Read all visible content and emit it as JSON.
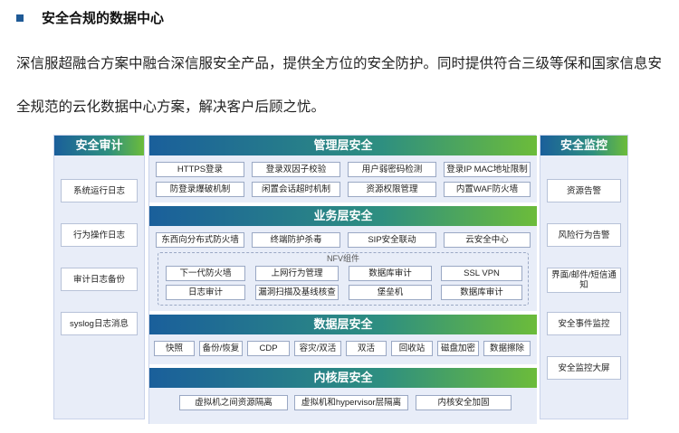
{
  "heading": "安全合规的数据中心",
  "paragraph": {
    "line1": "深信服超融合方案中融合深信服安全产品，提供全方位的安全防护。同时提供符合三级等保和国家信息安",
    "line2": "全规范的云化数据中心方案，解决客户后顾之忧。"
  },
  "left_panel": {
    "title": "安全审计",
    "items": [
      "系统运行日志",
      "行为操作日志",
      "审计日志备份",
      "syslog日志消息"
    ]
  },
  "right_panel": {
    "title": "安全监控",
    "items": [
      "资源告警",
      "风险行为告警",
      "界面/邮件/短信通知",
      "安全事件监控",
      "安全监控大屏"
    ]
  },
  "sections": {
    "management": {
      "title": "管理层安全",
      "row1": [
        "HTTPS登录",
        "登录双因子校验",
        "用户弱密码检测",
        "登录IP MAC地址限制"
      ],
      "row2": [
        "防登录爆破机制",
        "闲置会话超时机制",
        "资源权限管理",
        "内置WAF防火墙"
      ]
    },
    "business": {
      "title": "业务层安全",
      "row1": [
        "东西向分布式防火墙",
        "终端防护杀毒",
        "SIP安全联动",
        "云安全中心"
      ],
      "nfv_label": "NFV组件",
      "nfv_row1": [
        "下一代防火墙",
        "上网行为管理",
        "数据库审计",
        "SSL VPN"
      ],
      "nfv_row2": [
        "日志审计",
        "漏洞扫描及基线核查",
        "堡垒机",
        "数据库审计"
      ]
    },
    "data": {
      "title": "数据层安全",
      "items": [
        "快照",
        "备份/恢复",
        "CDP",
        "容灾/双活",
        "双活",
        "回收站",
        "磁盘加密",
        "数据擦除"
      ]
    },
    "kernel": {
      "title": "内核层安全",
      "items": [
        "虚拟机之间资源隔离",
        "虚拟机和hypervisor层隔离",
        "内核安全加固"
      ]
    }
  },
  "colors": {
    "gradient_start": "#1a5f9b",
    "gradient_mid": "#2e8f80",
    "gradient_end": "#6cbc3a",
    "panel_bg": "#e8edf8",
    "bullet": "#1f5a96"
  }
}
